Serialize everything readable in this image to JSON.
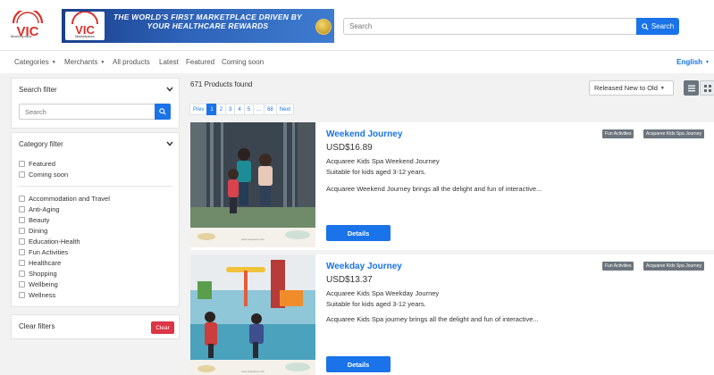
{
  "header": {
    "logo_text": "Marketplace",
    "banner_logo_text": "Marketplace",
    "banner_text": "THE WORLD'S FIRST MARKETPLACE DRIVEN BY YOUR HEALTHCARE REWARDS",
    "search_placeholder": "Search",
    "search_button": "Search"
  },
  "nav": {
    "items": [
      "Categories",
      "Merchants",
      "All products",
      "Latest",
      "Featured",
      "Coming soon"
    ],
    "language": "English"
  },
  "sidebar": {
    "search_filter_title": "Search filter",
    "search_placeholder": "Search",
    "category_filter_title": "Category filter",
    "special_options": [
      "Featured",
      "Coming soon"
    ],
    "categories": [
      "Accommodation and Travel",
      "Anti-Aging",
      "Beauty",
      "Dining",
      "Education-Health",
      "Fun Activities",
      "Healthcare",
      "Shopping",
      "Wellbeing",
      "Wellness"
    ],
    "clear_filters_label": "Clear filters",
    "clear_button": "Clear"
  },
  "results": {
    "count": "671 Products found",
    "sort_value": "Released New to Old",
    "pager": [
      "Prev",
      "1",
      "2",
      "3",
      "4",
      "5",
      "...",
      "68",
      "Next"
    ],
    "active_page": "1"
  },
  "products": [
    {
      "title": "Weekend Journey",
      "price": "USD$16.89",
      "merchant_line": "Acquaree Kids Spa Weekend Journey",
      "age_line": "Suitable for kids aged 3-12 years.",
      "description": "Acquaree Weekend Journey brings all the delight and fun of interactive...",
      "details_button": "Details",
      "tags": [
        "Fun Activities",
        "Acquaree Kids Spa Journey"
      ]
    },
    {
      "title": "Weekday Journey",
      "price": "USD$13.37",
      "merchant_line": "Acquaree Kids Spa Weekday Journey",
      "age_line": "Suitable for kids aged 3-12 years.",
      "description": "Acquaree Kids Spa journey brings all the delight and fun of interactive...",
      "details_button": "Details",
      "tags": [
        "Fun Activities",
        "Acquaree Kids Spa Journey"
      ]
    }
  ],
  "colors": {
    "accent": "#1a73e8",
    "danger": "#dc3545",
    "brand_red": "#d9312b",
    "banner_blue": "#1f4a9b",
    "tag_gray": "#6c757d"
  }
}
